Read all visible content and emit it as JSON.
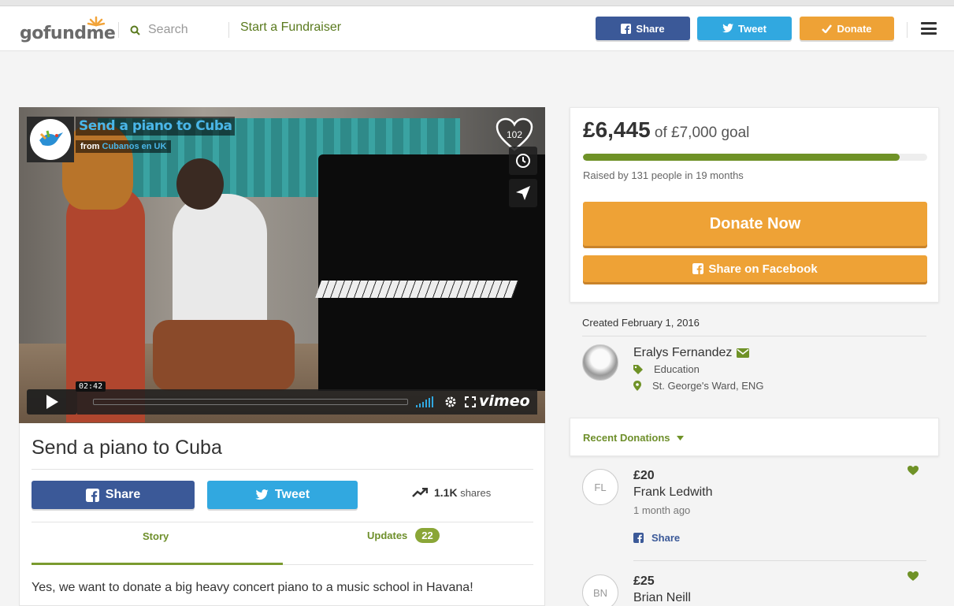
{
  "header": {
    "logo_text": "gofundme",
    "search_placeholder": "Search",
    "start_link": "Start a Fundraiser",
    "share_label": "Share",
    "tweet_label": "Tweet",
    "donate_label": "Donate",
    "icons": [
      "search-icon",
      "facebook-icon",
      "twitter-icon",
      "check-icon",
      "menu-icon"
    ]
  },
  "video": {
    "title_overlay": "Send a piano to Cuba",
    "from_prefix": "from",
    "from_name": "Cubanos en UK",
    "like_count": "102",
    "time": "02:42",
    "brand": "vimeo"
  },
  "campaign": {
    "title": "Send a piano to Cuba",
    "share_label": "Share",
    "tweet_label": "Tweet",
    "shares_count": "1.1K",
    "shares_label": "shares",
    "tabs": {
      "story": "Story",
      "updates": "Updates",
      "updates_count": "22"
    },
    "story_text": "Yes, we want to donate a big heavy concert piano to a music school in Havana!"
  },
  "funding": {
    "raised": "£6,445",
    "goal_text": "of £7,000 goal",
    "progress_fraction": 0.92,
    "raised_by_text": "Raised by 131 people in 19 months",
    "donate_now": "Donate Now",
    "share_facebook": "Share on Facebook"
  },
  "organizer": {
    "created_prefix": "Created",
    "created_date": "February 1, 2016",
    "name": "Eralys Fernandez",
    "category": "Education",
    "location": "St. George's Ward, ENG"
  },
  "donations": {
    "header": "Recent Donations",
    "items": [
      {
        "initials": "FL",
        "amount": "£20",
        "name": "Frank Ledwith",
        "time": "1 month ago",
        "share": "Share"
      },
      {
        "initials": "BN",
        "amount": "£25",
        "name": "Brian Neill"
      }
    ]
  },
  "colors": {
    "facebook": "#3b5998",
    "twitter": "#31a8e0",
    "donate": "#eea236",
    "green": "#6f9227"
  }
}
